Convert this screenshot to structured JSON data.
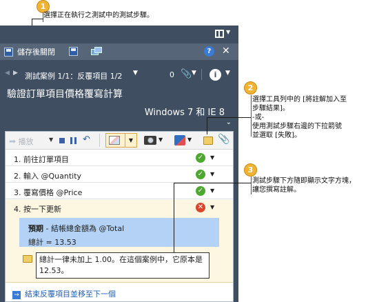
{
  "callouts": {
    "c1": {
      "number": "1",
      "text": "選擇正在執行之測試中的測試步驟。"
    },
    "c2": {
      "number": "2",
      "line1": "選擇工具列中的 [將註解加入至",
      "line2": "步驟結果]。",
      "line3": "-或-",
      "line4": "使用測試步驟右邊的下拉箭號",
      "line5": "並選取 [失敗]。"
    },
    "c3": {
      "number": "3",
      "line1": "測試步驟下方隨即顯示文字方塊，",
      "line2": "讓您撰寫註解。"
    }
  },
  "header": {
    "save_close": "儲存後關閉",
    "help": "?",
    "close": "✕"
  },
  "navigation": {
    "case_label": "測試案例 1/1：反覆項目 1/2",
    "attachment_count": "0",
    "info": "i"
  },
  "test": {
    "title": "驗證訂單項目價格覆寫計算",
    "environment": "Windows 7 和 IE 8"
  },
  "toolbar": {
    "play_label": "播放"
  },
  "steps": [
    {
      "number": "1.",
      "text": "前往訂單項目",
      "status": "pass"
    },
    {
      "number": "2.",
      "text": "輸入 @Quantity",
      "status": "pass"
    },
    {
      "number": "3.",
      "text": "覆寫價格 @Price",
      "status": "pass"
    },
    {
      "number": "4.",
      "text": "按一下更新",
      "status": "fail"
    }
  ],
  "expected": {
    "label": "預期",
    "text": " - 結帳總金額為 @Total",
    "total": "總計 = 13.53"
  },
  "comment": {
    "text": "總計一律未加上 1.00。在這個案例中，它原本是 12.53。"
  },
  "footer": {
    "next_iteration": "結束反覆項目並移至下一個"
  },
  "colors": {
    "panel": "#3f4f61",
    "toolbar": "#566678",
    "pass": "#4ea72e",
    "fail": "#d9462b",
    "expected_bg": "#b4d2f5",
    "callout": "#f2b233"
  }
}
